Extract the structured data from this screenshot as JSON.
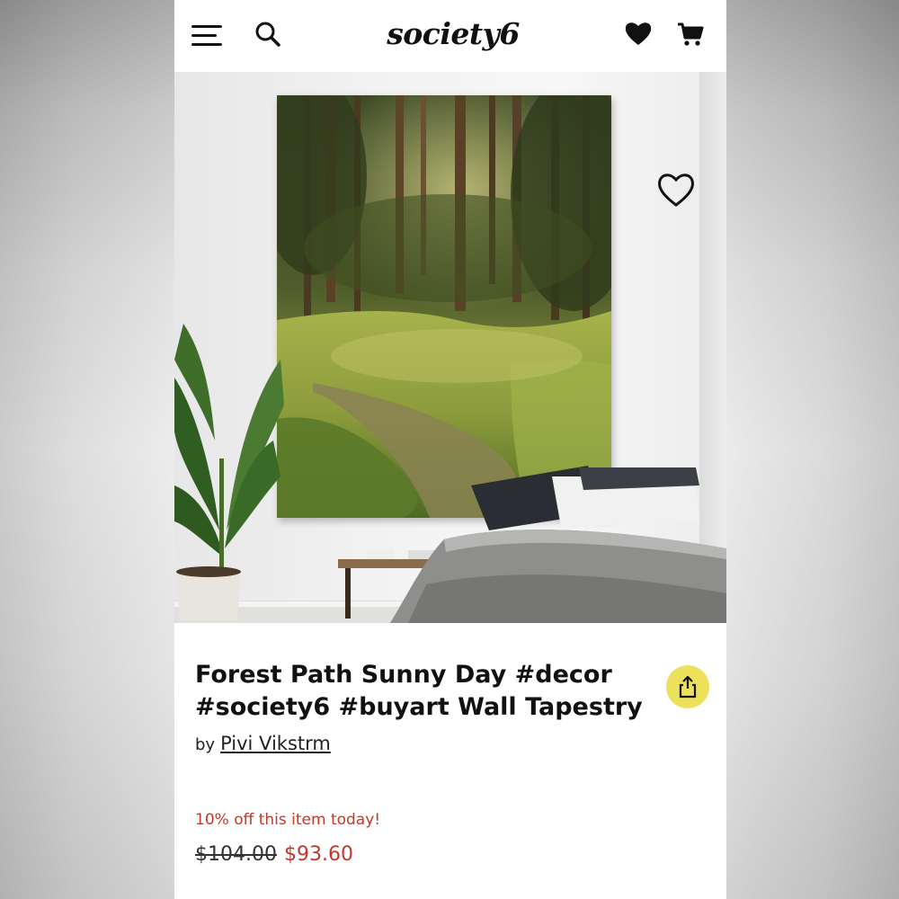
{
  "header": {
    "brand": "society6",
    "icons": [
      "menu-icon",
      "search-icon",
      "heart-icon",
      "cart-icon"
    ]
  },
  "product": {
    "title": "Forest Path Sunny Day #decor #society6 #buyart Wall Tapestry",
    "by_label": "by",
    "artist": "Pivi Vikstrm",
    "discount_note": "10% off this item today!",
    "original_price": "$104.00",
    "sale_price": "$93.60"
  },
  "colors": {
    "accent_yellow": "#ede05a",
    "sale_red": "#c0392b",
    "text": "#111111"
  }
}
